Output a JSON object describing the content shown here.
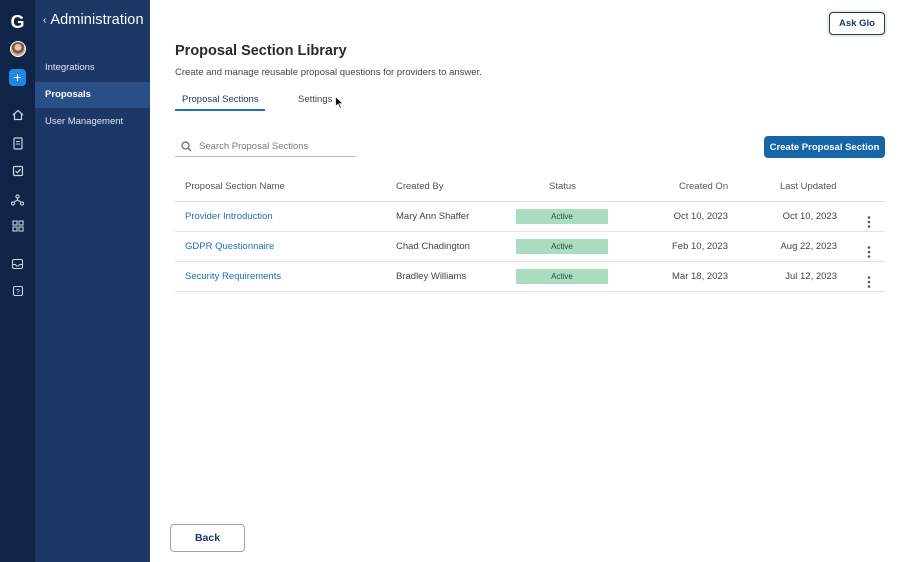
{
  "rail": {
    "logo_letter": "G",
    "icons": [
      "home-icon",
      "document-icon",
      "checklist-icon",
      "org-chart-icon",
      "apps-grid-icon",
      "inbox-icon",
      "help-icon"
    ],
    "plus_label": "+"
  },
  "sidebar": {
    "title": "Administration",
    "back_chevron": "‹",
    "items": [
      {
        "label": "Integrations",
        "active": false
      },
      {
        "label": "Proposals",
        "active": true
      },
      {
        "label": "User Management",
        "active": false
      }
    ]
  },
  "header": {
    "ask_glo_label": "Ask Glo",
    "title": "Proposal Section Library",
    "subtitle": "Create and manage reusable proposal questions for providers to answer."
  },
  "tabs": [
    {
      "label": "Proposal Sections",
      "active": true
    },
    {
      "label": "Settings",
      "active": false
    }
  ],
  "search": {
    "placeholder": "Search Proposal Sections",
    "value": ""
  },
  "create_button_label": "Create Proposal Section",
  "table": {
    "columns": [
      "Proposal Section Name",
      "Created By",
      "Status",
      "Created On",
      "Last Updated"
    ],
    "rows": [
      {
        "name": "Provider Introduction",
        "created_by": "Mary Ann Shaffer",
        "status": "Active",
        "created_on": "Oct 10, 2023",
        "last_updated": "Oct 10, 2023"
      },
      {
        "name": "GDPR Questionnaire",
        "created_by": "Chad Chadington",
        "status": "Active",
        "created_on": "Feb 10, 2023",
        "last_updated": "Aug 22, 2023"
      },
      {
        "name": "Security Requirements",
        "created_by": "Bradley Williams",
        "status": "Active",
        "created_on": "Mar 18, 2023",
        "last_updated": "Jul 12, 2023"
      }
    ]
  },
  "back_button_label": "Back",
  "colors": {
    "rail_bg": "#0f2447",
    "sidebar_bg": "#1d3866",
    "sidebar_active_bg": "#2a4f86",
    "primary": "#1565a8",
    "link": "#1d6fb8",
    "status_active_bg": "#a9dcc0"
  }
}
